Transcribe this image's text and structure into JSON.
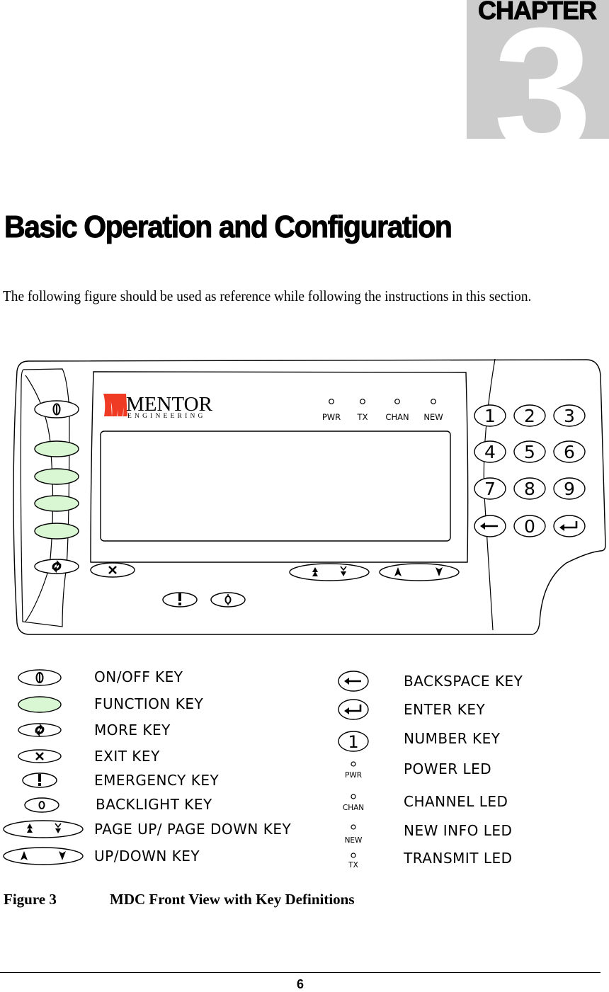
{
  "chapter": {
    "label": "CHAPTER",
    "number": "3"
  },
  "title": "Basic Operation and Configuration",
  "intro": "The following figure should be used as reference while following the instructions in this section.",
  "device": {
    "brand": {
      "name": "MENTOR",
      "subtitle": "ENGINEERING",
      "color": "#ef3b24"
    },
    "leds": [
      {
        "id": "pwr",
        "label": "PWR"
      },
      {
        "id": "tx",
        "label": "TX"
      },
      {
        "id": "chan",
        "label": "CHAN"
      },
      {
        "id": "new",
        "label": "NEW"
      }
    ],
    "keypad": [
      "1",
      "2",
      "3",
      "4",
      "5",
      "6",
      "7",
      "8",
      "9",
      "←",
      "0",
      "↵"
    ],
    "function_key_color": "#d9f7d3"
  },
  "legend": {
    "left": [
      {
        "icon": "on-off-icon",
        "label": "ON/OFF KEY"
      },
      {
        "icon": "function-key-icon",
        "label": "FUNCTION KEY"
      },
      {
        "icon": "more-icon",
        "label": "MORE KEY"
      },
      {
        "icon": "exit-icon",
        "label": "EXIT KEY"
      },
      {
        "icon": "emergency-icon",
        "label": "EMERGENCY KEY"
      },
      {
        "icon": "backlight-icon",
        "label": "BACKLIGHT KEY"
      },
      {
        "icon": "page-up-down-icon",
        "label": "PAGE UP/ PAGE DOWN KEY"
      },
      {
        "icon": "up-down-icon",
        "label": "UP/DOWN KEY"
      }
    ],
    "right": [
      {
        "icon": "backspace-icon",
        "label": "BACKSPACE KEY"
      },
      {
        "icon": "enter-icon",
        "label": "ENTER KEY"
      },
      {
        "icon": "number-key-icon",
        "label": "NUMBER KEY",
        "glyph": "1"
      },
      {
        "icon": "power-led-icon",
        "label": "POWER LED",
        "led": "PWR"
      },
      {
        "icon": "channel-led-icon",
        "label": "CHANNEL LED",
        "led": "CHAN"
      },
      {
        "icon": "new-info-led-icon",
        "label": "NEW INFO LED",
        "led": "NEW"
      },
      {
        "icon": "transmit-led-icon",
        "label": "TRANSMIT LED",
        "led": "TX"
      }
    ]
  },
  "figure": {
    "number": "Figure 3",
    "caption": "MDC Front View with Key Definitions"
  },
  "footer": {
    "page_number": "6"
  }
}
